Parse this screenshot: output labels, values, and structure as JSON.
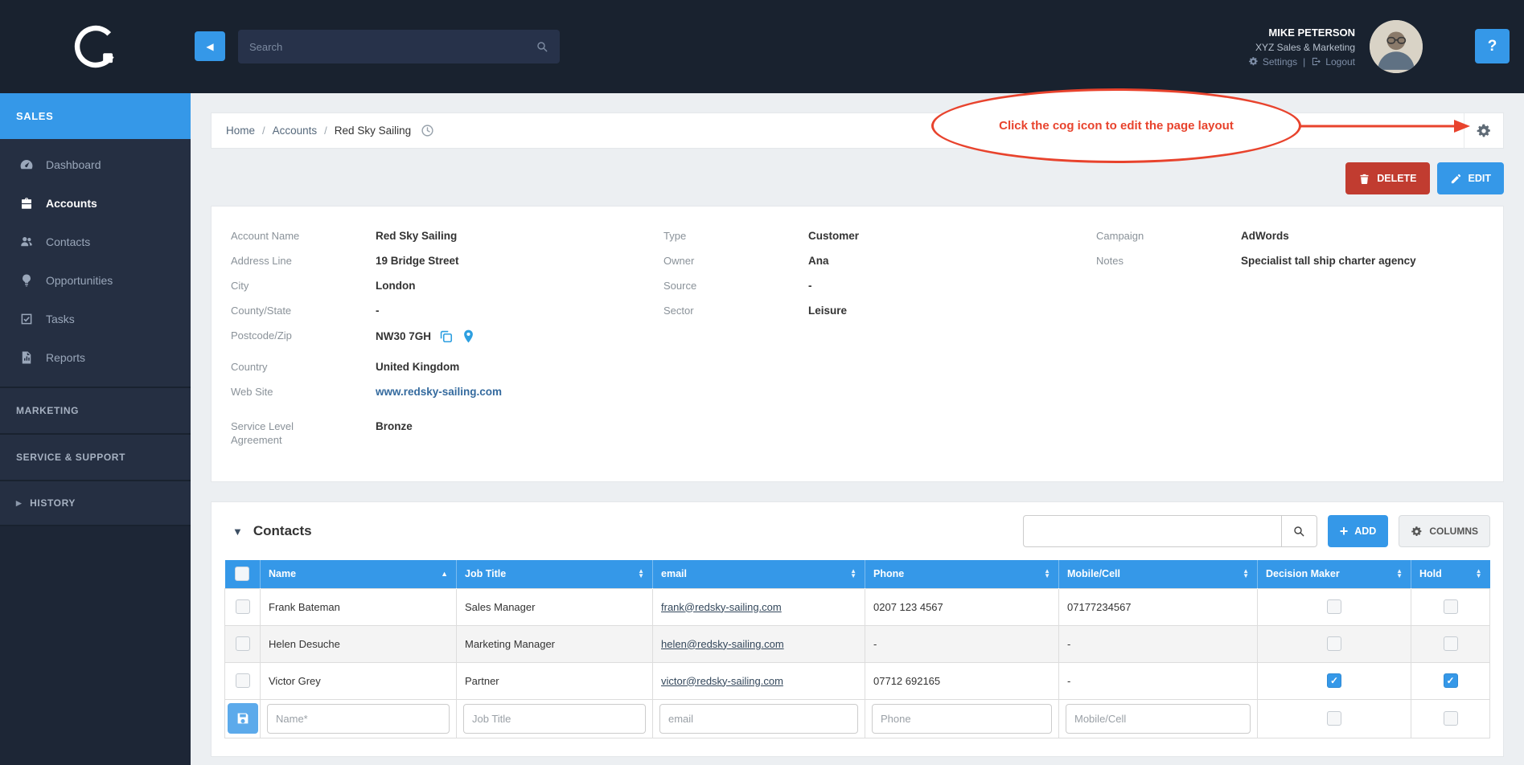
{
  "colors": {
    "accent": "#3598e8",
    "danger": "#c13c30",
    "annotation": "#e8432d",
    "dark": "#19222f"
  },
  "icons": {
    "plus": "+",
    "collapse": "◀",
    "caret_down": "▼",
    "history_arrow": "▸",
    "sort_asc": "▲",
    "sort_desc": "▼"
  },
  "sidebar": {
    "sections": {
      "sales": "SALES",
      "marketing": "MARKETING",
      "service": "SERVICE & SUPPORT",
      "history": "HISTORY"
    },
    "menu": [
      {
        "label": "Dashboard",
        "icon": "gauge-icon"
      },
      {
        "label": "Accounts",
        "icon": "briefcase-icon"
      },
      {
        "label": "Contacts",
        "icon": "users-icon"
      },
      {
        "label": "Opportunities",
        "icon": "lightbulb-icon"
      },
      {
        "label": "Tasks",
        "icon": "check-square-icon"
      },
      {
        "label": "Reports",
        "icon": "report-icon"
      }
    ]
  },
  "topbar": {
    "search_placeholder": "Search",
    "user": {
      "name": "MIKE PETERSON",
      "org": "XYZ Sales & Marketing",
      "settings": "Settings",
      "divider": "|",
      "logout": "Logout"
    },
    "help": "?"
  },
  "breadcrumb": {
    "home": "Home",
    "accounts": "Accounts",
    "current": "Red Sky Sailing",
    "separator": "/"
  },
  "annotation": {
    "text": "Click the cog icon to edit the page layout"
  },
  "actions": {
    "delete": "DELETE",
    "edit": "EDIT"
  },
  "account": {
    "col1": [
      {
        "label": "Account Name",
        "value": "Red Sky Sailing"
      },
      {
        "label": "Address Line",
        "value": "19 Bridge Street"
      },
      {
        "label": "City",
        "value": "London"
      },
      {
        "label": "County/State",
        "value": "-"
      },
      {
        "label": "Postcode/Zip",
        "value": "NW30 7GH"
      },
      {
        "label": "Country",
        "value": "United Kingdom"
      },
      {
        "label": "Web Site",
        "value": "www.redsky-sailing.com"
      },
      {
        "label": "Service Level Agreement",
        "value": "Bronze"
      }
    ],
    "col2": [
      {
        "label": "Type",
        "value": "Customer"
      },
      {
        "label": "Owner",
        "value": "Ana"
      },
      {
        "label": "Source",
        "value": "-"
      },
      {
        "label": "Sector",
        "value": "Leisure"
      }
    ],
    "col3": [
      {
        "label": "Campaign",
        "value": "AdWords"
      },
      {
        "label": "Notes",
        "value": "Specialist tall ship charter agency"
      }
    ]
  },
  "contacts": {
    "title": "Contacts",
    "add": "ADD",
    "columns": "COLUMNS",
    "table": {
      "headers": [
        "Name",
        "Job Title",
        "email",
        "Phone",
        "Mobile/Cell",
        "Decision Maker",
        "Hold"
      ],
      "rows": [
        {
          "name": "Frank Bateman",
          "job": "Sales Manager",
          "email": "frank@redsky-sailing.com",
          "phone": "0207 123 4567",
          "mobile": "07177234567",
          "decision": false,
          "hold": false
        },
        {
          "name": "Helen Desuche",
          "job": "Marketing Manager",
          "email": "helen@redsky-sailing.com",
          "phone": "-",
          "mobile": "-",
          "decision": false,
          "hold": false
        },
        {
          "name": "Victor Grey",
          "job": "Partner",
          "email": "victor@redsky-sailing.com",
          "phone": "07712 692165",
          "mobile": "-",
          "decision": true,
          "hold": true
        }
      ],
      "new_row": {
        "name": "Name*",
        "job": "Job Title",
        "email": "email",
        "phone": "Phone",
        "mobile": "Mobile/Cell"
      }
    }
  }
}
